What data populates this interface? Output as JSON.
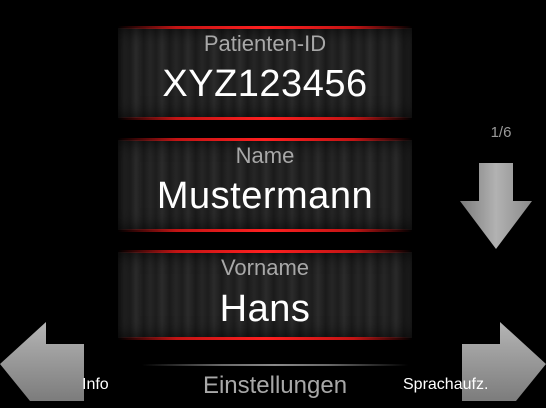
{
  "fields": {
    "patient_id": {
      "label": "Patienten-ID",
      "value": "XYZ123456"
    },
    "name": {
      "label": "Name",
      "value": "Mustermann"
    },
    "vorname": {
      "label": "Vorname",
      "value": "Hans"
    }
  },
  "pagination": {
    "text": "1/6"
  },
  "bottom": {
    "left_label": "Info",
    "center_label": "Einstellungen",
    "right_label": "Sprachaufz."
  },
  "icons": {
    "next_page": "arrow-down-icon",
    "back": "arrow-left-icon",
    "forward": "arrow-right-icon"
  },
  "colors": {
    "background": "#000000",
    "accent_red": "#ff2020",
    "arrow_gray": "#9c9c9c",
    "label_gray": "#a8a8a8",
    "value_white": "#ffffff"
  }
}
